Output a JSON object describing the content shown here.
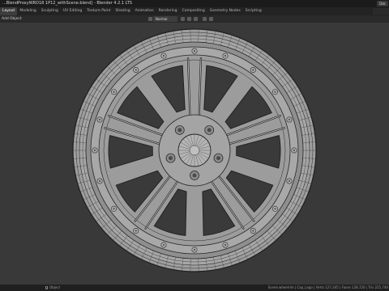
{
  "window": {
    "title": "...BlendProxyWRD18 1P12_withScene.blend] - Blender 4.2.1 LTS",
    "user_button": "Dsk"
  },
  "workspace_tabs": [
    {
      "label": "Layout",
      "active": true
    },
    {
      "label": "Modeling",
      "active": false
    },
    {
      "label": "Sculpting",
      "active": false
    },
    {
      "label": "UV Editing",
      "active": false
    },
    {
      "label": "Texture Paint",
      "active": false
    },
    {
      "label": "Shading",
      "active": false
    },
    {
      "label": "Animation",
      "active": false
    },
    {
      "label": "Rendering",
      "active": false
    },
    {
      "label": "Compositing",
      "active": false
    },
    {
      "label": "Geometry Nodes",
      "active": false
    },
    {
      "label": "Scripting",
      "active": false
    }
  ],
  "header": {
    "add_menu": "Add",
    "object_menu": "Object",
    "orientation": "Normal"
  },
  "status": {
    "hint": "Object",
    "stats": "Scene.wheelrim | Cap_Logo | Verts 127,345 | Faces 128,720 | Tris 225,746"
  },
  "colors": {
    "viewport_bg": "#393939",
    "rim_fill": "#a9a9a9",
    "wire": "#262626",
    "window_hole": "#3a3a3a"
  }
}
